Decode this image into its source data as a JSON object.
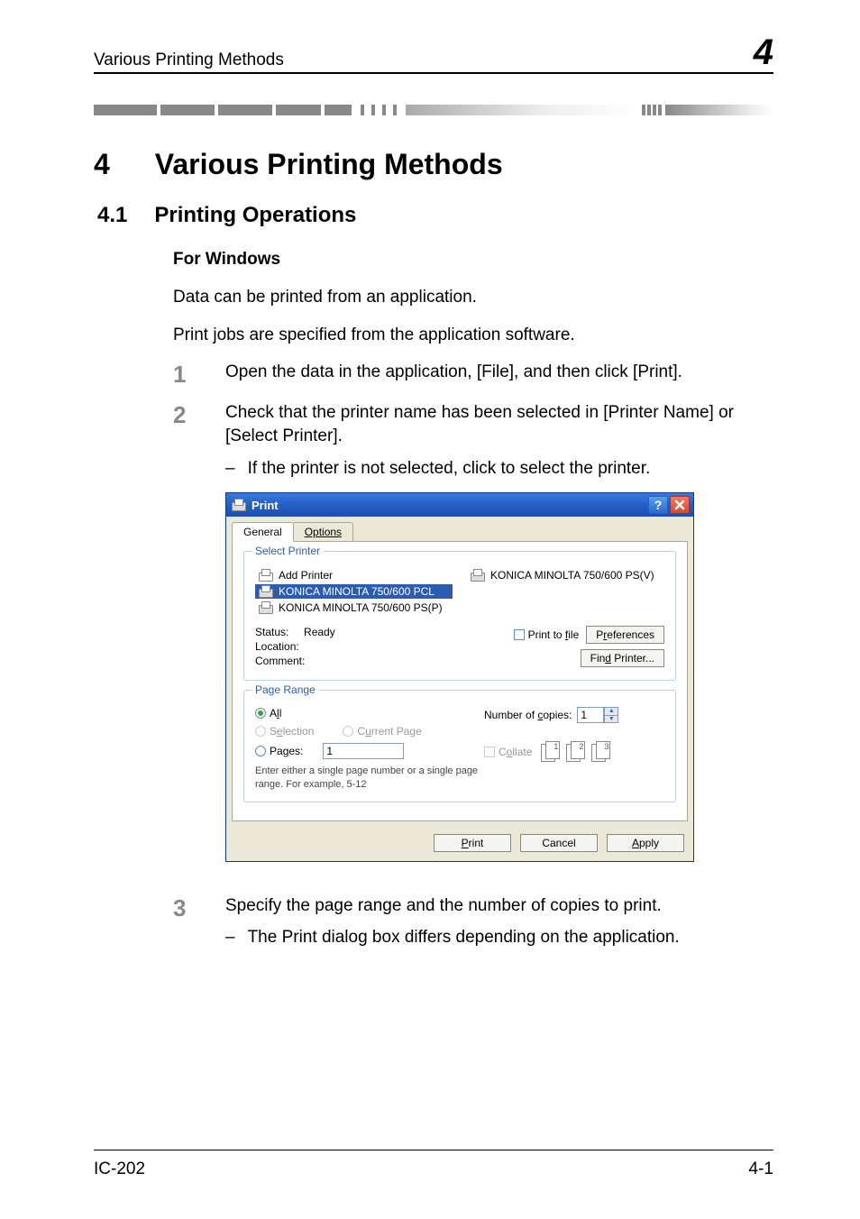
{
  "running_head": {
    "text": "Various Printing Methods",
    "number": "4"
  },
  "chapter": {
    "number": "4",
    "title": "Various Printing Methods"
  },
  "section": {
    "number": "4.1",
    "title": "Printing Operations"
  },
  "subheading": "For Windows",
  "paragraphs": {
    "p1": "Data can be printed from an application.",
    "p2": "Print jobs are specified from the application software."
  },
  "steps": {
    "s1": {
      "num": "1",
      "text": "Open the data in the application, [File], and then click [Print]."
    },
    "s2": {
      "num": "2",
      "text": "Check that the printer name has been selected in [Printer Name] or [Select Printer].",
      "sub": "If the printer is not selected, click to select the printer."
    },
    "s3": {
      "num": "3",
      "text": "Specify the page range and the number of copies to print.",
      "sub": "The Print dialog box differs depending on the application."
    }
  },
  "dialog": {
    "title": "Print",
    "tabs": {
      "general": "General",
      "options": "Options"
    },
    "select_printer": {
      "legend": "Select Printer",
      "items": {
        "add": "Add Printer",
        "pcl": "KONICA MINOLTA 750/600 PCL",
        "psp": "KONICA MINOLTA 750/600 PS(P)",
        "psv": "KONICA MINOLTA 750/600 PS(V)"
      },
      "status_lbl": "Status:",
      "status_val": "Ready",
      "location_lbl": "Location:",
      "comment_lbl": "Comment:",
      "print_to_file": "Print to file",
      "preferences": "Preferences",
      "find_printer": "Find Printer..."
    },
    "page_range": {
      "legend": "Page Range",
      "all": "All",
      "selection": "Selection",
      "current": "Current Page",
      "pages": "Pages:",
      "pages_value": "1",
      "hint": "Enter either a single page number or a single page range.  For example, 5-12",
      "copies_label": "Number of copies:",
      "copies_value": "1",
      "collate": "Collate",
      "collate_nums": {
        "a": "1",
        "b": "2",
        "c": "3"
      }
    },
    "buttons": {
      "print": "Print",
      "cancel": "Cancel",
      "apply": "Apply"
    }
  },
  "footer": {
    "left": "IC-202",
    "right": "4-1"
  },
  "dash": "–"
}
